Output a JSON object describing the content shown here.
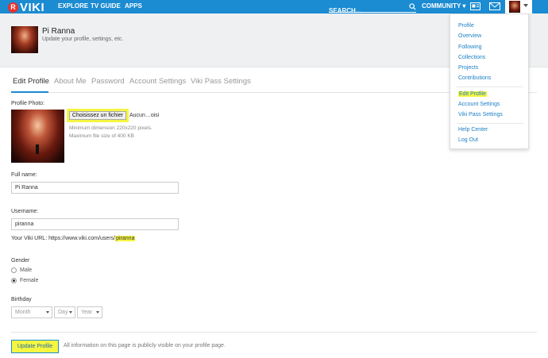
{
  "nav": {
    "logo_mark": "R",
    "logo": "VIKI",
    "explore": "EXPLORE",
    "tv_guide": "TV GUIDE",
    "apps": "APPS",
    "search_placeholder": "SEARCH...",
    "community": "COMMUNITY",
    "accent_color": "#1b8bd2"
  },
  "profile": {
    "name": "Pi Ranna",
    "subtitle": "Update your profile, settings, etc."
  },
  "tabs": [
    {
      "label": "Edit Profile",
      "active": true
    },
    {
      "label": "About Me",
      "active": false
    },
    {
      "label": "Password",
      "active": false
    },
    {
      "label": "Account Settings",
      "active": false
    },
    {
      "label": "Viki Pass Settings",
      "active": false
    }
  ],
  "form": {
    "photo_label": "Profile Photo:",
    "file_button": "Choisissez un fichier",
    "file_name": "Aucun…oisi",
    "min_dimension": "Minimum dimension 220x220 pixels.",
    "max_size": "Maximum file size of 400 KB",
    "fullname_label": "Full name:",
    "fullname_value": "Pi Ranna",
    "username_label": "Username:",
    "username_value": "piranna",
    "url_prefix": "Your Viki URL: https://www.viki.com/users/",
    "url_user": "piranna",
    "gender_label": "Gender",
    "gender_male": "Male",
    "gender_female": "Female",
    "gender_selected": "Female",
    "birthday_label": "Birthday",
    "month": "Month",
    "day": "Day",
    "year": "Year",
    "update_button": "Update Profile",
    "update_note": "All information on this page is publicly visible on your profile page."
  },
  "dropdown": {
    "group1": [
      "Profile",
      "Overview",
      "Following",
      "Collections",
      "Projects",
      "Contributions"
    ],
    "group2": [
      "Edit Profile",
      "Account Settings",
      "Viki Pass Settings"
    ],
    "group3": [
      "Help Center",
      "Log Out"
    ]
  }
}
